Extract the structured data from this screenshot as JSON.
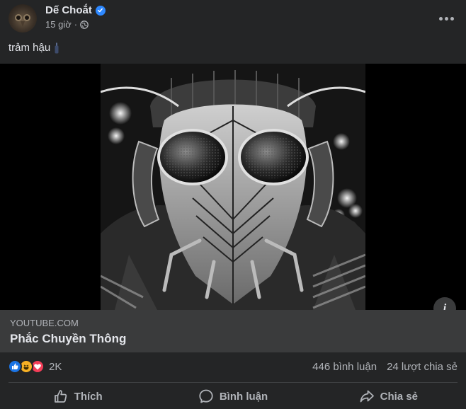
{
  "post": {
    "author": "Dế Choắt",
    "verified": true,
    "time": "15 giờ",
    "separator": "·",
    "privacy_icon": "globe-icon",
    "caption": "trảm hậu",
    "caption_icon": "bottle-icon"
  },
  "media": {
    "description_icon": "info-icon"
  },
  "link": {
    "domain": "YOUTUBE.COM",
    "title": "Phắc Chuyền Thông"
  },
  "stats": {
    "reactions": [
      "like",
      "haha",
      "love"
    ],
    "reaction_count": "2K",
    "comments": "446 bình luận",
    "shares": "24 lượt chia sẻ"
  },
  "actions": {
    "like": "Thích",
    "comment": "Bình luận",
    "share": "Chia sẻ"
  },
  "colors": {
    "background": "#242526",
    "card": "#3a3b3c",
    "text_primary": "#e4e6eb",
    "text_secondary": "#b0b3b8",
    "verified": "#2d88ff",
    "like": "#1b74e4",
    "haha": "#f7b125",
    "love": "#f33e58"
  }
}
